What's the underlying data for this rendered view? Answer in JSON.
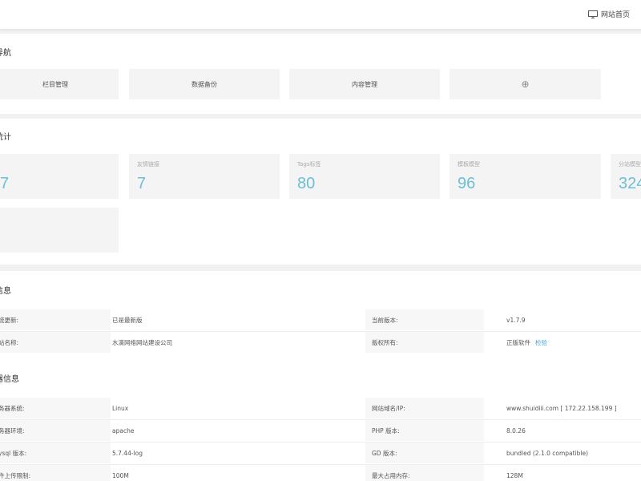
{
  "header": {
    "home_label": "网站首页"
  },
  "nav": {
    "title": "导航",
    "items": [
      {
        "label": "栏目管理"
      },
      {
        "label": "数据备份"
      },
      {
        "label": "内容管理"
      },
      {
        "label": "⊕"
      }
    ]
  },
  "stats": {
    "title": "统计",
    "cards": [
      {
        "label": "",
        "value": "7"
      },
      {
        "label": "友情链接",
        "value": "7"
      },
      {
        "label": "Tags标签",
        "value": "80"
      },
      {
        "label": "模板模型",
        "value": "96"
      },
      {
        "label": "分站模型",
        "value": "324"
      },
      {
        "label": "",
        "value": ""
      }
    ]
  },
  "system": {
    "title": "信息",
    "rows": [
      {
        "l1": "统更新:",
        "v1": "已是最新版",
        "l2": "当前版本:",
        "v2": "v1.7.9"
      },
      {
        "l1": "站名称:",
        "v1": "水滴网络网站建设公司",
        "l2": "版权所有:",
        "v2": "正版软件",
        "v2_link": "检验"
      }
    ]
  },
  "server": {
    "title": "器信息",
    "rows": [
      {
        "l1": "务器系统:",
        "v1": "Linux",
        "l2": "网站域名/IP:",
        "v2": "www.shuidiii.com [ 172.22.158.199 ]"
      },
      {
        "l1": "务器环境:",
        "v1": "apache",
        "l2": "PHP 版本:",
        "v2": "8.0.26"
      },
      {
        "l1": "ysql 版本:",
        "v1": "5.7.44-log",
        "l2": "GD 版本:",
        "v2": "bundled (2.1.0 compatible)"
      },
      {
        "l1": "件上传限制:",
        "v1": "100M",
        "l2": "最大占用内存:",
        "v2": "128M"
      }
    ]
  },
  "colors": {
    "accent": "#6bbfd8",
    "link": "#4aa4d8",
    "card_bg": "#f4f4f4"
  }
}
